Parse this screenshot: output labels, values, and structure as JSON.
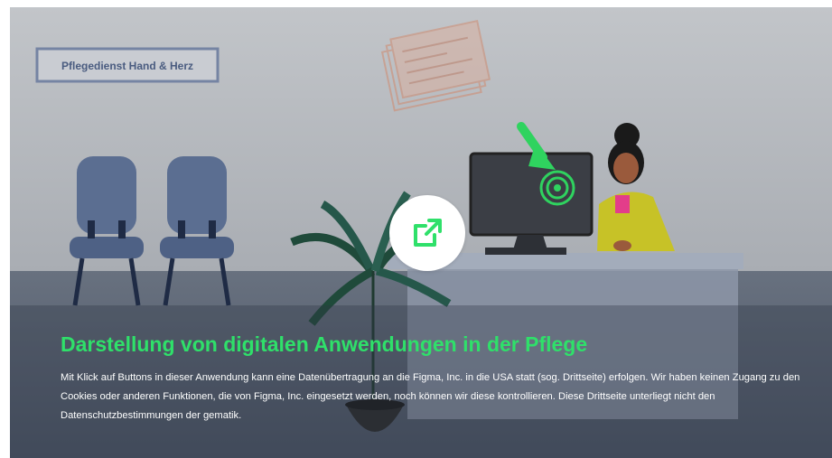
{
  "media": {
    "sign_label": "Pflegedienst Hand & Herz",
    "headline": "Darstellung von digitalen Anwendungen in der Pflege",
    "disclaimer": "Mit Klick auf Buttons in dieser Anwendung kann eine Datenübertragung an die Figma, Inc. in die USA statt (sog. Drittseite) erfolgen. Wir haben keinen Zugang zu den Cookies oder anderen Funktionen, die von Figma, Inc. eingesetzt werden, noch können wir diese kontrollieren. Diese Drittseite unterliegt nicht den Datenschutzbestimmungen der gematik.",
    "open_button_icon": "external-link-icon"
  },
  "colors": {
    "accent": "#2fe06a",
    "wall": "#b7babf",
    "floor": "#5e6777",
    "chair": "#5a6d8e",
    "desk": "#9aa4b4",
    "sign_border": "#6f7fa0",
    "sign_text": "#4a5c80"
  }
}
